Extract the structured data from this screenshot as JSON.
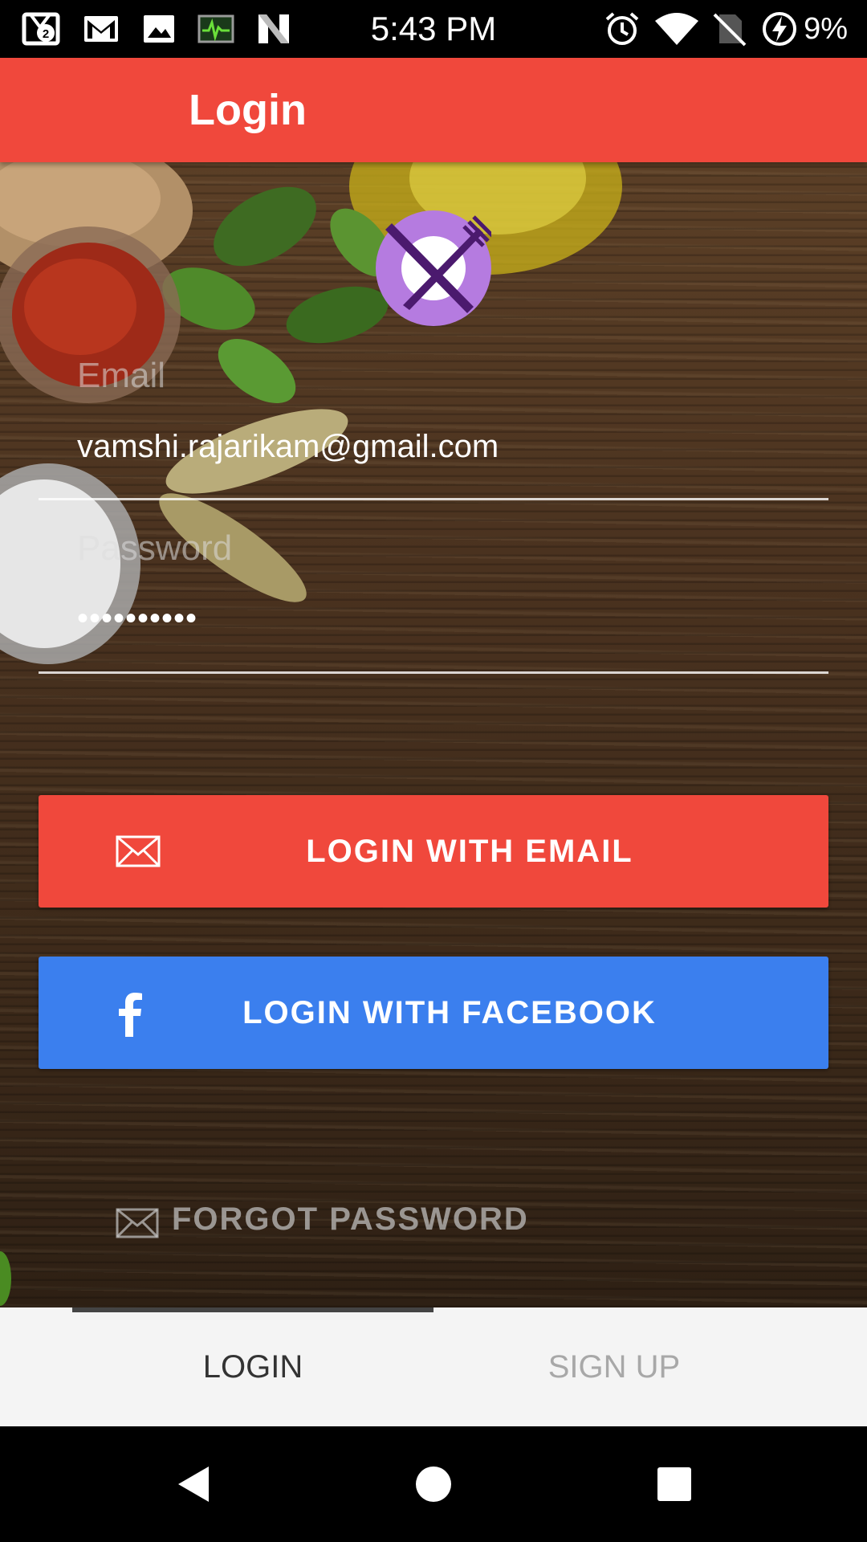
{
  "status_bar": {
    "time": "5:43 PM",
    "battery_percent": "9%",
    "notification_badge": "2",
    "icons": [
      "notification-stack-icon",
      "gmail-icon",
      "gallery-icon",
      "activity-monitor-icon",
      "n-app-icon",
      "alarm-icon",
      "wifi-icon",
      "no-sim-icon",
      "battery-charging-icon"
    ]
  },
  "app_bar": {
    "title": "Login"
  },
  "logo": {
    "icon": "plate-cutlery-icon",
    "color": "#B57BE0"
  },
  "form": {
    "email": {
      "label": "Email",
      "value": "vamshi.rajarikam@gmail.com"
    },
    "password": {
      "label": "Password",
      "value": "••••••••••"
    }
  },
  "buttons": {
    "login_email": {
      "label": "LOGIN WITH EMAIL",
      "icon": "envelope-icon",
      "color": "#F0483C"
    },
    "login_facebook": {
      "label": "LOGIN WITH FACEBOOK",
      "icon": "facebook-icon",
      "color": "#3B7FEE"
    }
  },
  "forgot_password": {
    "label": "FORGOT PASSWORD",
    "icon": "envelope-icon"
  },
  "tabs": [
    {
      "label": "LOGIN",
      "selected": true
    },
    {
      "label": "SIGN UP",
      "selected": false
    }
  ],
  "nav_bar": {
    "buttons": [
      "back-icon",
      "home-icon",
      "recents-icon"
    ]
  }
}
